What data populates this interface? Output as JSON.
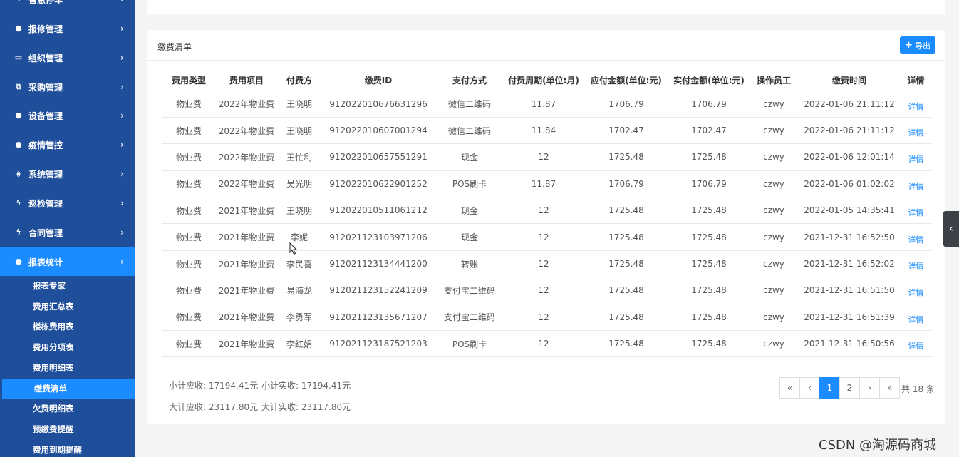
{
  "sidebar": {
    "menus": [
      {
        "label": "智慧停车",
        "icon": "bolt-icon"
      },
      {
        "label": "报修管理",
        "icon": "disc-icon"
      },
      {
        "label": "组织管理",
        "icon": "monitor-icon"
      },
      {
        "label": "采购管理",
        "icon": "copy-icon"
      },
      {
        "label": "设备管理",
        "icon": "disc-icon"
      },
      {
        "label": "疫情管控",
        "icon": "disc-icon"
      },
      {
        "label": "系统管理",
        "icon": "diamond-icon"
      },
      {
        "label": "巡检管理",
        "icon": "bolt-icon"
      },
      {
        "label": "合同管理",
        "icon": "bolt-icon"
      },
      {
        "label": "报表统计",
        "icon": "disc-icon"
      }
    ],
    "submenus": [
      "报表专家",
      "费用汇总表",
      "楼栋费用表",
      "费用分项表",
      "费用明细表",
      "缴费清单",
      "欠费明细表",
      "预缴费提醒",
      "费用到期提醒"
    ]
  },
  "panel": {
    "title": "缴费清单",
    "export_label": "导出"
  },
  "table": {
    "headers": [
      "费用类型",
      "费用项目",
      "付费方",
      "缴费ID",
      "支付方式",
      "付费周期(单位:月)",
      "应付金额(单位:元)",
      "实付金额(单位:元)",
      "操作员工",
      "缴费时间",
      "详情"
    ],
    "rows": [
      [
        "物业费",
        "2022年物业费",
        "王晓明",
        "912022010676631296",
        "微信二维码",
        "11.87",
        "1706.79",
        "1706.79",
        "czwy",
        "2022-01-06 21:11:12",
        "详情"
      ],
      [
        "物业费",
        "2022年物业费",
        "王晓明",
        "912022010607001294",
        "微信二维码",
        "11.84",
        "1702.47",
        "1702.47",
        "czwy",
        "2022-01-06 21:11:12",
        "详情"
      ],
      [
        "物业费",
        "2022年物业费",
        "王忙利",
        "912022010657551291",
        "现金",
        "12",
        "1725.48",
        "1725.48",
        "czwy",
        "2022-01-06 12:01:14",
        "详情"
      ],
      [
        "物业费",
        "2022年物业费",
        "吴光明",
        "912022010622901252",
        "POS刷卡",
        "11.87",
        "1706.79",
        "1706.79",
        "czwy",
        "2022-01-06 01:02:02",
        "详情"
      ],
      [
        "物业费",
        "2021年物业费",
        "王晓明",
        "912022010511061212",
        "现金",
        "12",
        "1725.48",
        "1725.48",
        "czwy",
        "2022-01-05 14:35:41",
        "详情"
      ],
      [
        "物业费",
        "2021年物业费",
        "李妮",
        "912021123103971206",
        "现金",
        "12",
        "1725.48",
        "1725.48",
        "czwy",
        "2021-12-31 16:52:50",
        "详情"
      ],
      [
        "物业费",
        "2021年物业费",
        "李民喜",
        "912021123134441200",
        "转账",
        "12",
        "1725.48",
        "1725.48",
        "czwy",
        "2021-12-31 16:52:02",
        "详情"
      ],
      [
        "物业费",
        "2021年物业费",
        "易海龙",
        "912021123152241209",
        "支付宝二维码",
        "12",
        "1725.48",
        "1725.48",
        "czwy",
        "2021-12-31 16:51:50",
        "详情"
      ],
      [
        "物业费",
        "2021年物业费",
        "李勇军",
        "912021123135671207",
        "支付宝二维码",
        "12",
        "1725.48",
        "1725.48",
        "czwy",
        "2021-12-31 16:51:39",
        "详情"
      ],
      [
        "物业费",
        "2021年物业费",
        "李红娟",
        "912021123187521203",
        "POS刷卡",
        "12",
        "1725.48",
        "1725.48",
        "czwy",
        "2021-12-31 16:50:56",
        "详情"
      ]
    ]
  },
  "summary": {
    "subtotal_due": "小计应收: 17194.41元",
    "subtotal_paid": "小计实收: 17194.41元",
    "total_due": "大计应收: 23117.80元",
    "total_paid": "大计实收: 23117.80元"
  },
  "pagination": {
    "first": "«",
    "prev": "‹",
    "pages": [
      "1",
      "2"
    ],
    "current": "1",
    "next": "›",
    "last": "»",
    "total": "共 18 条"
  },
  "watermark": "CSDN @淘源码商城",
  "colors": {
    "sidebar_bg": "#1f4e9a",
    "accent": "#1a8cff"
  }
}
